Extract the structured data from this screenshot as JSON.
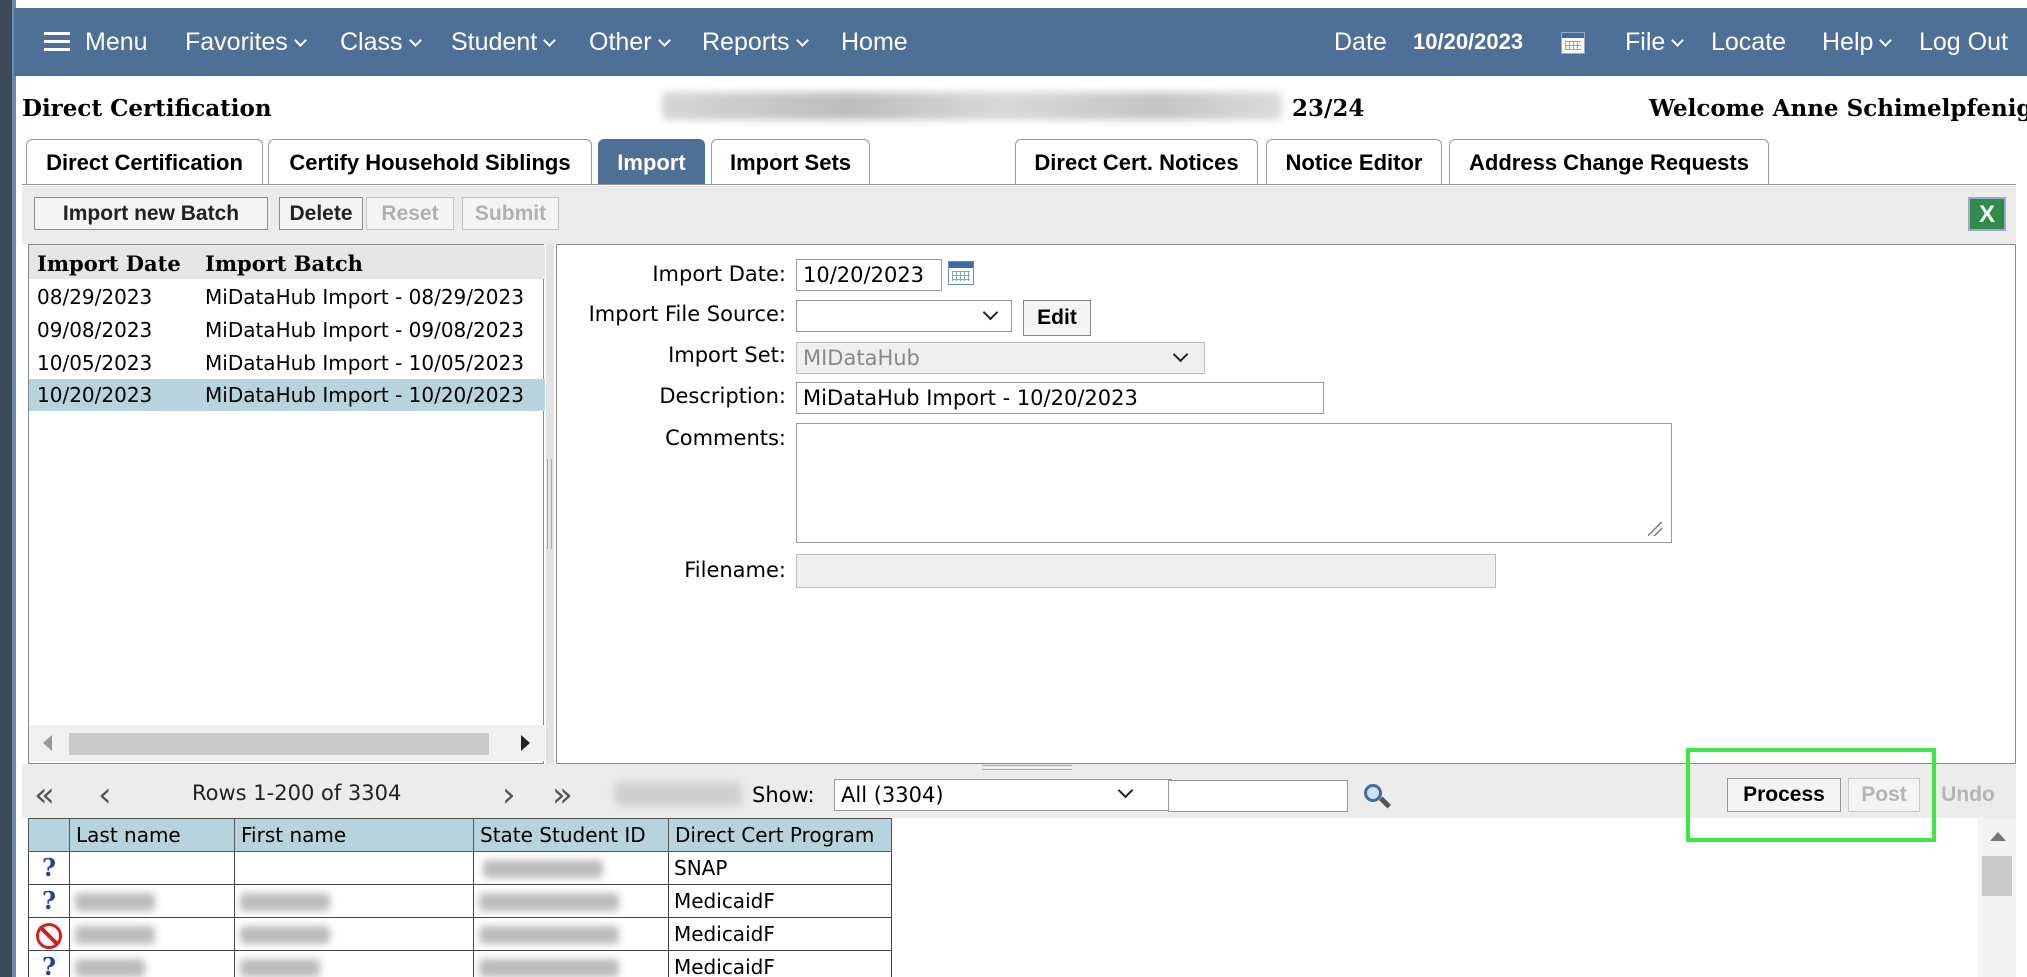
{
  "nav": {
    "menu": "Menu",
    "items": [
      "Favorites",
      "Class",
      "Student",
      "Other",
      "Reports"
    ],
    "home": "Home",
    "date_label": "Date",
    "date_value": "10/20/2023",
    "right_items": [
      "File",
      "Locate",
      "Help",
      "Log Out"
    ]
  },
  "header": {
    "title": "Direct Certification",
    "school_year": "23/24",
    "welcome": "Welcome Anne Schimelpfenig"
  },
  "tabs": [
    {
      "label": "Direct Certification",
      "active": false
    },
    {
      "label": "Certify Household Siblings",
      "active": false
    },
    {
      "label": "Import",
      "active": true
    },
    {
      "label": "Import Sets",
      "active": false
    },
    {
      "label": "Direct Cert. Notices",
      "active": false
    },
    {
      "label": "Notice Editor",
      "active": false
    },
    {
      "label": "Address Change Requests",
      "active": false
    }
  ],
  "toolbar": {
    "import_new_batch": "Import new Batch",
    "delete": "Delete",
    "reset": "Reset",
    "submit": "Submit"
  },
  "batch_list": {
    "columns": [
      "Import Date",
      "Import Batch"
    ],
    "rows": [
      {
        "date": "08/29/2023",
        "batch": "MiDataHub Import - 08/29/2023"
      },
      {
        "date": "09/08/2023",
        "batch": "MiDataHub Import - 09/08/2023"
      },
      {
        "date": "10/05/2023",
        "batch": "MiDataHub Import - 10/05/2023"
      },
      {
        "date": "10/20/2023",
        "batch": "MiDataHub Import - 10/20/2023",
        "selected": true
      }
    ]
  },
  "form": {
    "import_date_label": "Import Date:",
    "import_date_value": "10/20/2023",
    "file_source_label": "Import File Source:",
    "file_source_value": "",
    "edit_button": "Edit",
    "import_set_label": "Import Set:",
    "import_set_value": "MIDataHub",
    "description_label": "Description:",
    "description_value": "MiDataHub Import - 10/20/2023",
    "comments_label": "Comments:",
    "comments_value": "",
    "filename_label": "Filename:",
    "filename_value": ""
  },
  "grid_toolbar": {
    "rows_text": "Rows 1-200 of 3304",
    "show_label": "Show:",
    "show_value": "All (3304)",
    "process": "Process",
    "post": "Post",
    "undo": "Undo"
  },
  "grid": {
    "columns": [
      "Last name",
      "First name",
      "State Student ID",
      "Direct Cert Program"
    ],
    "rows": [
      {
        "status": "question",
        "program": "SNAP"
      },
      {
        "status": "question",
        "program": "MedicaidF"
      },
      {
        "status": "blocked",
        "program": "MedicaidF"
      },
      {
        "status": "question",
        "program": "MedicaidF"
      }
    ]
  },
  "colors": {
    "nav_bg": "#4f7096",
    "selected_row": "#b7d3dd",
    "highlight": "#3fe840"
  }
}
